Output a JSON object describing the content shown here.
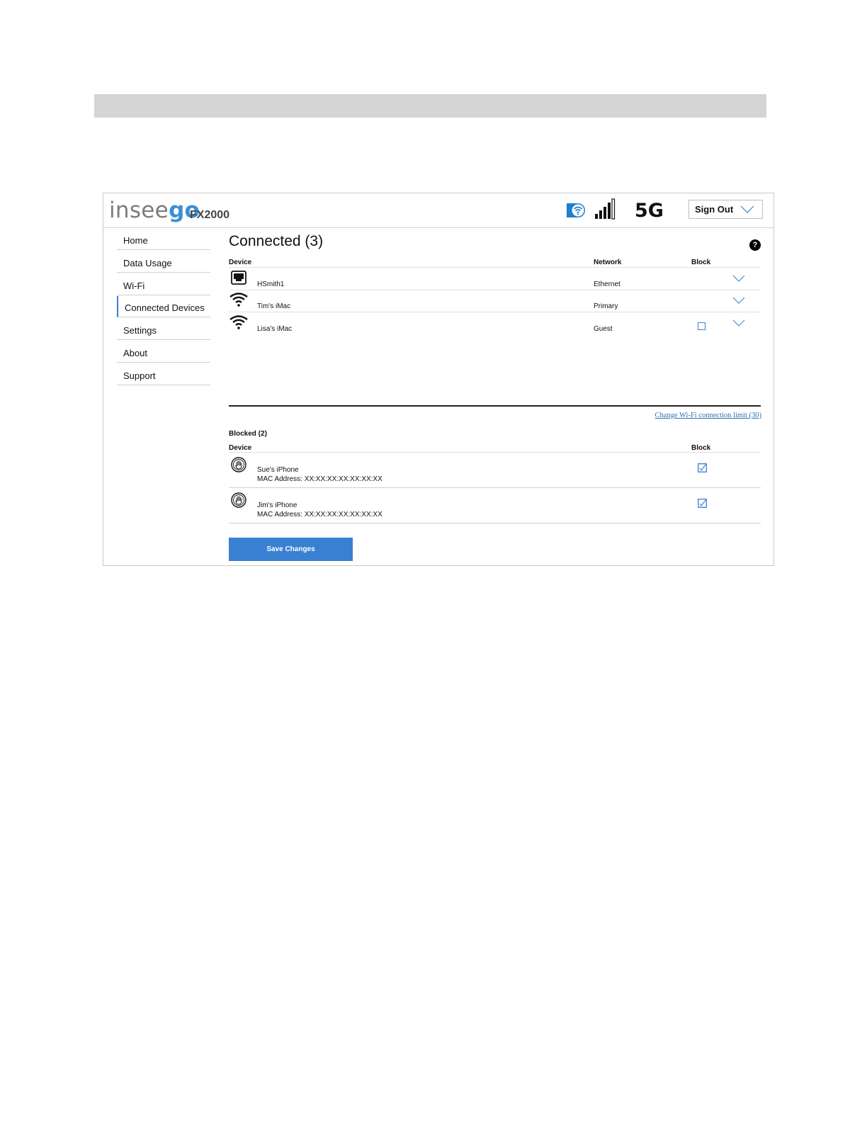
{
  "brand": {
    "logo_part1": "insee",
    "logo_part2": "go",
    "model": "FX2000"
  },
  "status": {
    "network_type": "5G",
    "wifi_icon": "wifi-badge-icon",
    "signal_icon": "signal-bars-icon"
  },
  "header": {
    "sign_out_label": "Sign Out"
  },
  "sidebar": {
    "items": [
      {
        "label": "Home",
        "active": false
      },
      {
        "label": "Data Usage",
        "active": false
      },
      {
        "label": "Wi-Fi",
        "active": false
      },
      {
        "label": "Connected Devices",
        "active": true
      },
      {
        "label": "Settings",
        "active": false
      },
      {
        "label": "About",
        "active": false
      },
      {
        "label": "Support",
        "active": false
      }
    ]
  },
  "connected": {
    "title": "Connected (3)",
    "columns": {
      "device": "Device",
      "network": "Network",
      "block": "Block"
    },
    "devices": [
      {
        "name": "HSmith1",
        "network": "Ethernet",
        "icon": "ethernet-icon",
        "block_checkbox": false
      },
      {
        "name": "Tim's iMac",
        "network": "Primary",
        "icon": "wifi-icon",
        "block_checkbox": false
      },
      {
        "name": "Lisa's iMac",
        "network": "Guest",
        "icon": "wifi-icon",
        "block_checkbox": true,
        "blocked": false
      }
    ],
    "limit_link": "Change Wi-Fi connection limit (30)"
  },
  "blocked": {
    "title": "Blocked (2)",
    "columns": {
      "device": "Device",
      "block": "Block"
    },
    "devices": [
      {
        "name": "Sue's iPhone",
        "mac": "MAC Address: XX:XX:XX:XX:XX:XX:XX",
        "blocked": true
      },
      {
        "name": "Jim's iPhone",
        "mac": "MAC Address: XX:XX:XX:XX:XX:XX:XX",
        "blocked": true
      }
    ]
  },
  "actions": {
    "save_label": "Save Changes"
  },
  "colors": {
    "accent": "#3a80d2",
    "logo_gray": "#7c7c7c",
    "logo_blue": "#3a8fd6"
  }
}
